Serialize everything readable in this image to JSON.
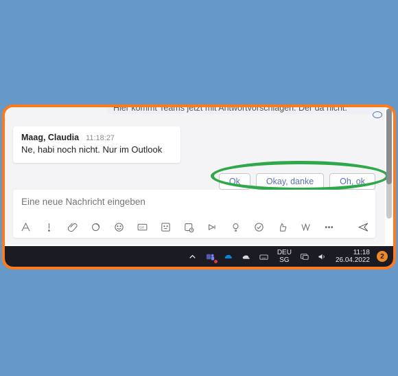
{
  "chat": {
    "prev_snippet_text": "Hier kommt Teams jetzt mit Antwortvorschlägen. Der da nicht.",
    "message": {
      "author": "Maag, Claudia",
      "time": "11:18:27",
      "body": "Ne, habi noch nicht. Nur im Outlook"
    },
    "suggestions": [
      "Ok",
      "Okay, danke",
      "Oh, ok"
    ]
  },
  "compose": {
    "placeholder": "Eine neue Nachricht eingeben"
  },
  "taskbar": {
    "lang_top": "DEU",
    "lang_bottom": "SG",
    "time": "11:18",
    "date": "26.04.2022",
    "notif_count": "2"
  }
}
